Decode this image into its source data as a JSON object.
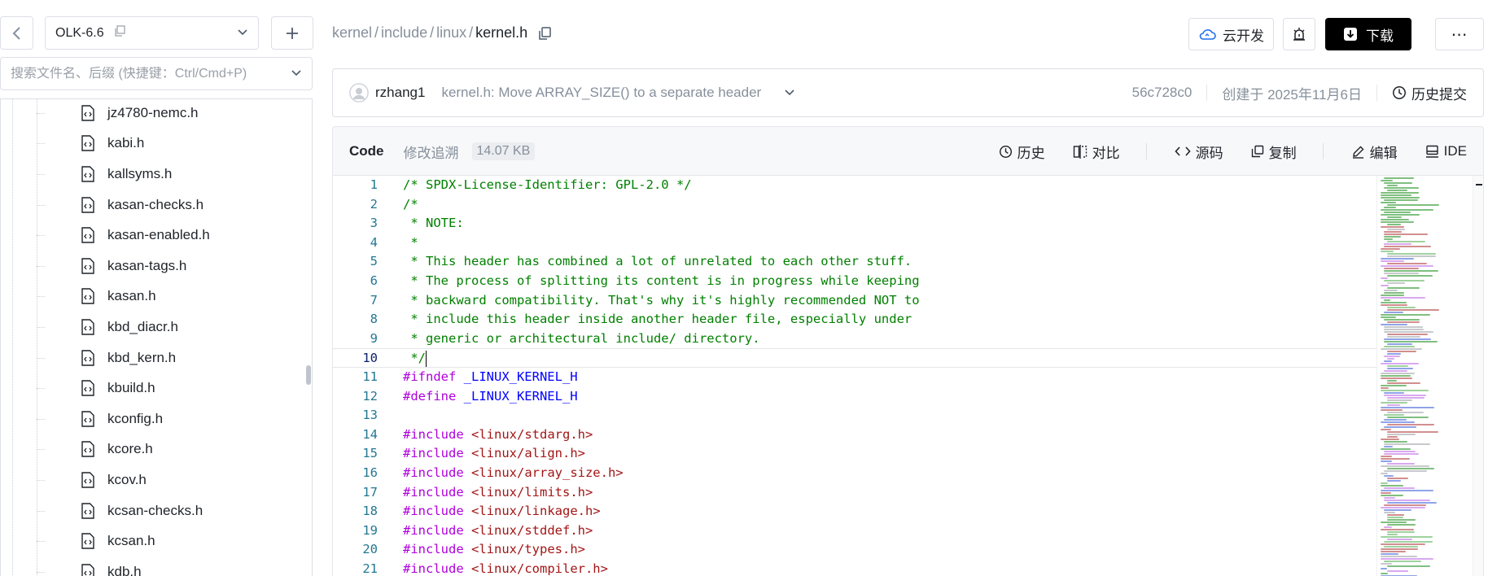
{
  "sidebar": {
    "branch": "OLK-6.6",
    "search_placeholder": "搜索文件名、后缀 (快捷键：Ctrl/Cmd+P)",
    "files": [
      "jz4780-nemc.h",
      "kabi.h",
      "kallsyms.h",
      "kasan-checks.h",
      "kasan-enabled.h",
      "kasan-tags.h",
      "kasan.h",
      "kbd_diacr.h",
      "kbd_kern.h",
      "kbuild.h",
      "kconfig.h",
      "kcore.h",
      "kcov.h",
      "kcsan-checks.h",
      "kcsan.h",
      "kdb.h"
    ]
  },
  "breadcrumb": {
    "segments": [
      "kernel",
      "include",
      "linux"
    ],
    "current": "kernel.h"
  },
  "actions": {
    "cloud_dev": "云开发",
    "download": "下载"
  },
  "commit": {
    "author": "rzhang1",
    "message": "kernel.h: Move ARRAY_SIZE() to a separate header",
    "hash": "56c728c0",
    "created": "创建于 2025年11月6日",
    "history": "历史提交"
  },
  "toolbar": {
    "tab_code": "Code",
    "tab_blame": "修改追溯",
    "size": "14.07 KB",
    "history": "历史",
    "compare": "对比",
    "source": "源码",
    "copy": "复制",
    "edit": "编辑",
    "ide": "IDE"
  },
  "code": {
    "active_line": 10,
    "lines": [
      {
        "n": "1",
        "parts": [
          {
            "t": "/* SPDX-License-Identifier: GPL-2.0 */",
            "c": "cmt"
          }
        ]
      },
      {
        "n": "2",
        "parts": [
          {
            "t": "/*",
            "c": "cmt"
          }
        ]
      },
      {
        "n": "3",
        "parts": [
          {
            "t": " * NOTE:",
            "c": "cmt"
          }
        ]
      },
      {
        "n": "4",
        "parts": [
          {
            "t": " *",
            "c": "cmt"
          }
        ]
      },
      {
        "n": "5",
        "parts": [
          {
            "t": " * This header has combined a lot of unrelated to each other stuff.",
            "c": "cmt"
          }
        ]
      },
      {
        "n": "6",
        "parts": [
          {
            "t": " * The process of splitting its content is in progress while keeping",
            "c": "cmt"
          }
        ]
      },
      {
        "n": "7",
        "parts": [
          {
            "t": " * backward compatibility. That's why it's highly recommended NOT to",
            "c": "cmt"
          }
        ]
      },
      {
        "n": "8",
        "parts": [
          {
            "t": " * include this header inside another header file, especially under",
            "c": "cmt"
          }
        ]
      },
      {
        "n": "9",
        "parts": [
          {
            "t": " * generic or architectural include/ directory.",
            "c": "cmt"
          }
        ]
      },
      {
        "n": "10",
        "parts": [
          {
            "t": " */",
            "c": "cmt"
          }
        ]
      },
      {
        "n": "11",
        "parts": [
          {
            "t": "#ifndef ",
            "c": "pp"
          },
          {
            "t": "_LINUX_KERNEL_H",
            "c": "macro"
          }
        ]
      },
      {
        "n": "12",
        "parts": [
          {
            "t": "#define ",
            "c": "pp"
          },
          {
            "t": "_LINUX_KERNEL_H",
            "c": "macro"
          }
        ]
      },
      {
        "n": "13",
        "parts": []
      },
      {
        "n": "14",
        "parts": [
          {
            "t": "#include ",
            "c": "pp"
          },
          {
            "t": "<linux/stdarg.h>",
            "c": "inc"
          }
        ]
      },
      {
        "n": "15",
        "parts": [
          {
            "t": "#include ",
            "c": "pp"
          },
          {
            "t": "<linux/align.h>",
            "c": "inc"
          }
        ]
      },
      {
        "n": "16",
        "parts": [
          {
            "t": "#include ",
            "c": "pp"
          },
          {
            "t": "<linux/array_size.h>",
            "c": "inc"
          }
        ]
      },
      {
        "n": "17",
        "parts": [
          {
            "t": "#include ",
            "c": "pp"
          },
          {
            "t": "<linux/limits.h>",
            "c": "inc"
          }
        ]
      },
      {
        "n": "18",
        "parts": [
          {
            "t": "#include ",
            "c": "pp"
          },
          {
            "t": "<linux/linkage.h>",
            "c": "inc"
          }
        ]
      },
      {
        "n": "19",
        "parts": [
          {
            "t": "#include ",
            "c": "pp"
          },
          {
            "t": "<linux/stddef.h>",
            "c": "inc"
          }
        ]
      },
      {
        "n": "20",
        "parts": [
          {
            "t": "#include ",
            "c": "pp"
          },
          {
            "t": "<linux/types.h>",
            "c": "inc"
          }
        ]
      },
      {
        "n": "21",
        "parts": [
          {
            "t": "#include ",
            "c": "pp"
          },
          {
            "t": "<linux/compiler.h>",
            "c": "inc"
          }
        ]
      }
    ]
  },
  "colors": {
    "comment": "#008000",
    "preprocessor": "#af00db",
    "macro": "#0000ff",
    "include_path": "#a31515",
    "line_number": "#237893",
    "download_bg": "#000000"
  }
}
